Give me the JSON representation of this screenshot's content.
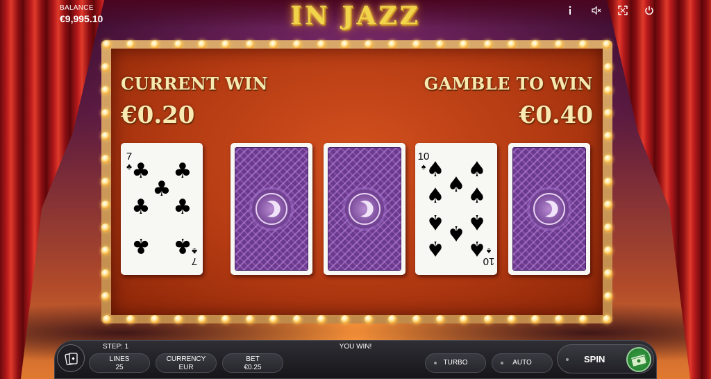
{
  "header": {
    "balance_label": "BALANCE",
    "balance_value": "€9,995.10",
    "logo_text": "IN JAZZ",
    "icons": [
      "info-icon",
      "sound-muted-icon",
      "fullscreen-icon",
      "power-icon"
    ]
  },
  "gamble": {
    "current_win_label": "CURRENT WIN",
    "current_win_value": "€0.20",
    "gamble_to_win_label": "GAMBLE TO WIN",
    "gamble_to_win_value": "€0.40"
  },
  "cards": [
    {
      "state": "face-up",
      "rank": "7",
      "suit": "clubs",
      "suit_symbol": "♣"
    },
    {
      "state": "face-down"
    },
    {
      "state": "face-down"
    },
    {
      "state": "face-up",
      "rank": "10",
      "suit": "spades",
      "suit_symbol": "♠"
    },
    {
      "state": "face-down"
    }
  ],
  "bottom_bar": {
    "step_label": "STEP: 1",
    "status_text": "YOU WIN!",
    "lines_label": "LINES",
    "lines_value": "25",
    "currency_label": "CURRENCY",
    "currency_value": "EUR",
    "bet_label": "BET",
    "bet_value": "€0.25",
    "turbo_label": "TURBO",
    "auto_label": "AUTO",
    "spin_label": "SPIN"
  },
  "colors": {
    "logo_gold": "#f2d44a",
    "board_red": "#b33a12",
    "card_back_purple": "#6a3a8e",
    "win_text": "#f6e9b0"
  }
}
